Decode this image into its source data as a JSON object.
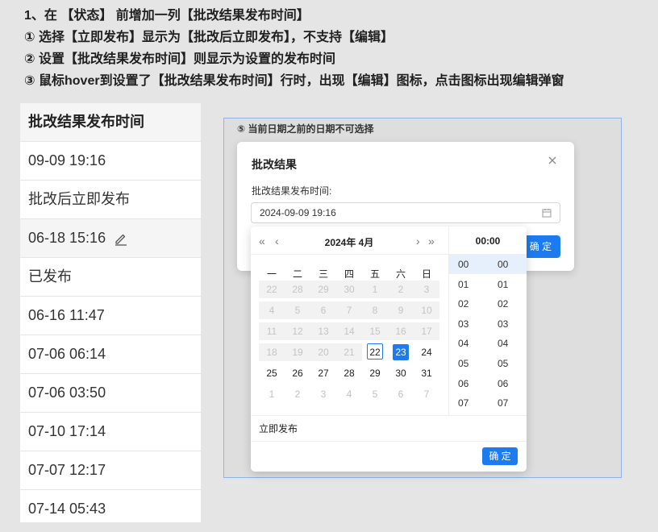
{
  "notes": [
    "1、在 【状态】 前增加一列【批改结果发布时间】",
    "① 选择【立即发布】显示为【批改后立即发布】，不支持【编辑】",
    "② 设置【批改结果发布时间】则显示为设置的发布时间",
    "③ 鼠标hover到设置了【批改结果发布时间】行时，出现【编辑】图标，点击图标出现编辑弹窗"
  ],
  "table": {
    "header": "批改结果发布时间",
    "rows": [
      "09-09 19:16",
      "批改后立即发布",
      "06-18 15:16",
      "已发布",
      "06-16 11:47",
      "07-06 06:14",
      "07-06 03:50",
      "07-10 17:14",
      "07-07 12:17",
      "07-14 05:43"
    ]
  },
  "demo": {
    "note": "⑤ 当前日期之前的日期不可选择",
    "modal": {
      "title": "批改结果",
      "field_label": "批改结果发布时间:",
      "input_value": "2024-09-09 19:16",
      "ok_label": "确 定"
    },
    "picker": {
      "prev_year": "«",
      "prev_month": "‹",
      "next_month": "›",
      "next_year": "»",
      "month_title": "2024年  4月",
      "weekdays": [
        "一",
        "二",
        "三",
        "四",
        "五",
        "六",
        "日"
      ],
      "weeks": [
        [
          "22",
          "28",
          "29",
          "30",
          "1",
          "2",
          "3"
        ],
        [
          "4",
          "5",
          "6",
          "7",
          "8",
          "9",
          "10"
        ],
        [
          "11",
          "12",
          "13",
          "14",
          "15",
          "16",
          "17"
        ],
        [
          "18",
          "19",
          "20",
          "21",
          "22",
          "23",
          "24"
        ],
        [
          "25",
          "26",
          "27",
          "28",
          "29",
          "30",
          "31"
        ],
        [
          "1",
          "2",
          "3",
          "4",
          "5",
          "6",
          "7"
        ]
      ],
      "time_title": "00:00",
      "hours": [
        "00",
        "01",
        "02",
        "03",
        "04",
        "05",
        "06",
        "07"
      ],
      "minutes": [
        "00",
        "01",
        "02",
        "03",
        "04",
        "05",
        "06",
        "07"
      ],
      "now_label": "立即发布",
      "ok_label": "确 定"
    }
  },
  "colors": {
    "accent": "#1d7bf0",
    "disabled_bg": "#f2f2f2",
    "hover_row": "#f5f5f5"
  }
}
